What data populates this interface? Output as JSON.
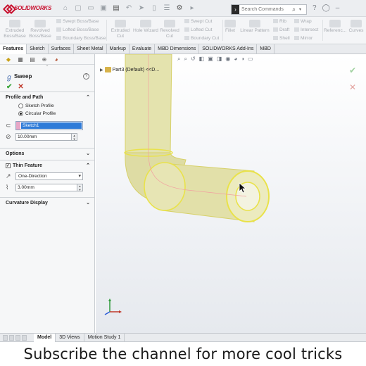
{
  "app": {
    "name": "SOLIDWORKS"
  },
  "search": {
    "placeholder": "Search Commands"
  },
  "command_manager": {
    "big": [
      {
        "label_1": "Extruded",
        "label_2": "Boss/Base"
      },
      {
        "label_1": "Revolved",
        "label_2": "Boss/Base"
      },
      {
        "label_1": "Extruded",
        "label_2": "Cut"
      },
      {
        "label_1": "Hole Wizard",
        "label_2": ""
      },
      {
        "label_1": "Revolved",
        "label_2": "Cut"
      },
      {
        "label_1": "Fillet",
        "label_2": ""
      },
      {
        "label_1": "Linear Pattern",
        "label_2": ""
      },
      {
        "label_1": "Referenc...",
        "label_2": ""
      },
      {
        "label_1": "Curves",
        "label_2": ""
      }
    ],
    "small": [
      "Swept Boss/Base",
      "Lofted Boss/Base",
      "Boundary Boss/Base",
      "Swept Cut",
      "Lofted Cut",
      "Boundary Cut",
      "Rib",
      "Draft",
      "Shell",
      "Wrap",
      "Intersect",
      "Mirror"
    ]
  },
  "tabs": [
    "Features",
    "Sketch",
    "Surfaces",
    "Sheet Metal",
    "Markup",
    "Evaluate",
    "MBD Dimensions",
    "SOLIDWORKS Add-Ins",
    "MBD"
  ],
  "property_manager": {
    "title": "Sweep",
    "profile_section": "Profile and Path",
    "sketch_profile": "Sketch Profile",
    "circular_profile": "Circular Profile",
    "path_value": "Sketch1",
    "diameter": "10.00mm",
    "options_section": "Options",
    "thin_feature": "Thin Feature",
    "thin_type": "One-Direction",
    "thickness": "3.00mm",
    "curvature_section": "Curvature Display"
  },
  "viewport": {
    "tree_node": "Part3 (Default) <<D..."
  },
  "bottom_tabs": [
    "Model",
    "3D Views",
    "Motion Study 1"
  ],
  "caption": "Subscribe the channel for more cool tricks",
  "colors": {
    "accent_red": "#c8102e",
    "selection_blue": "#2f7bd8",
    "tube_fill": "#e4e3ae",
    "tube_edge": "#e9e24a"
  }
}
